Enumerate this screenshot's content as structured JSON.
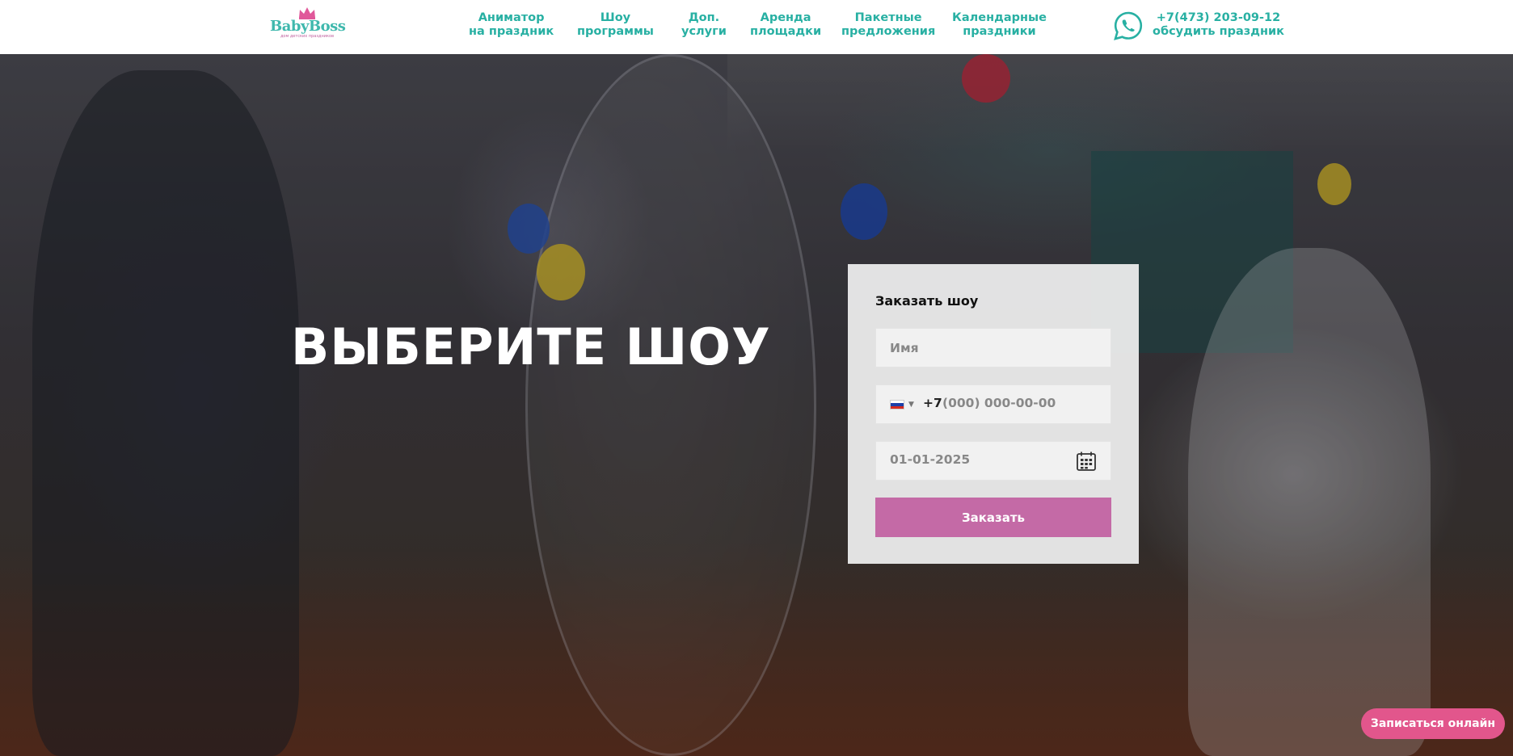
{
  "logo": {
    "brand": "BabyBoss",
    "tagline": "дом детских праздников",
    "brand_color": "#3fb8ad",
    "crown_color": "#e0589a"
  },
  "nav": {
    "items": [
      {
        "line1": "Аниматор",
        "line2": "на праздник"
      },
      {
        "line1": "Шоу",
        "line2": "программы"
      },
      {
        "line1": "Доп.",
        "line2": "услуги"
      },
      {
        "line1": "Аренда",
        "line2": "площадки"
      },
      {
        "line1": "Пакетные",
        "line2": "предложения"
      },
      {
        "line1": "Календарные",
        "line2": "праздники"
      }
    ],
    "color": "#28b0a3"
  },
  "contact": {
    "phone": "+7(473) 203-09-12",
    "cta": "обсудить праздник",
    "icon": "whatsapp-icon"
  },
  "hero": {
    "title": "ВЫБЕРИТЕ ШОУ"
  },
  "form": {
    "title": "Заказать шоу",
    "name_placeholder": "Имя",
    "phone_country": "ru-flag",
    "phone_prefix": "+7",
    "phone_mask": "(000) 000-00-00",
    "date_value": "01-01-2025",
    "submit_label": "Заказать",
    "submit_color": "#c46aa6"
  },
  "online_button": {
    "label": "Записаться онлайн",
    "color": "#e2568c"
  }
}
